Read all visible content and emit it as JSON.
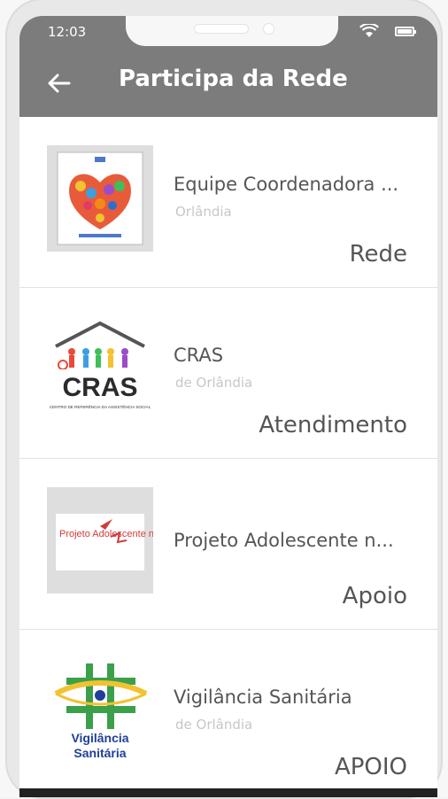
{
  "status_bar": {
    "time": "12:03",
    "icons": [
      "wifi-icon",
      "battery-icon"
    ]
  },
  "app_bar": {
    "title": "Participa da Rede",
    "back_icon": "arrow-left-icon"
  },
  "items": [
    {
      "name": "Equipe Coordenadora ...",
      "subtitle": "Orlândia",
      "category": "Rede",
      "thumb_icon": "heart-logo-icon"
    },
    {
      "name": "CRAS",
      "subtitle": "de Orlândia",
      "category": "Atendimento",
      "thumb_text": "CRAS",
      "thumb_caption": "CENTRO DE REFERÊNCIA DA ASSISTÊNCIA SOCIAL",
      "thumb_icon": "cras-logo-icon"
    },
    {
      "name": "Projeto Adolescente n...",
      "subtitle": "",
      "category": "Apoio",
      "thumb_text": "Projeto Adolescente no Espaço",
      "thumb_icon": "projeto-logo-icon"
    },
    {
      "name": "Vigilância Sanitária",
      "subtitle": "de Orlândia",
      "category": "APOIO",
      "thumb_text_line1": "Vigilância",
      "thumb_text_line2": "Sanitária",
      "thumb_icon": "vigilancia-logo-icon"
    }
  ],
  "colors": {
    "app_bar": "#7c7c7c",
    "primary_text": "#555555",
    "secondary_text": "#c7c7c7"
  }
}
